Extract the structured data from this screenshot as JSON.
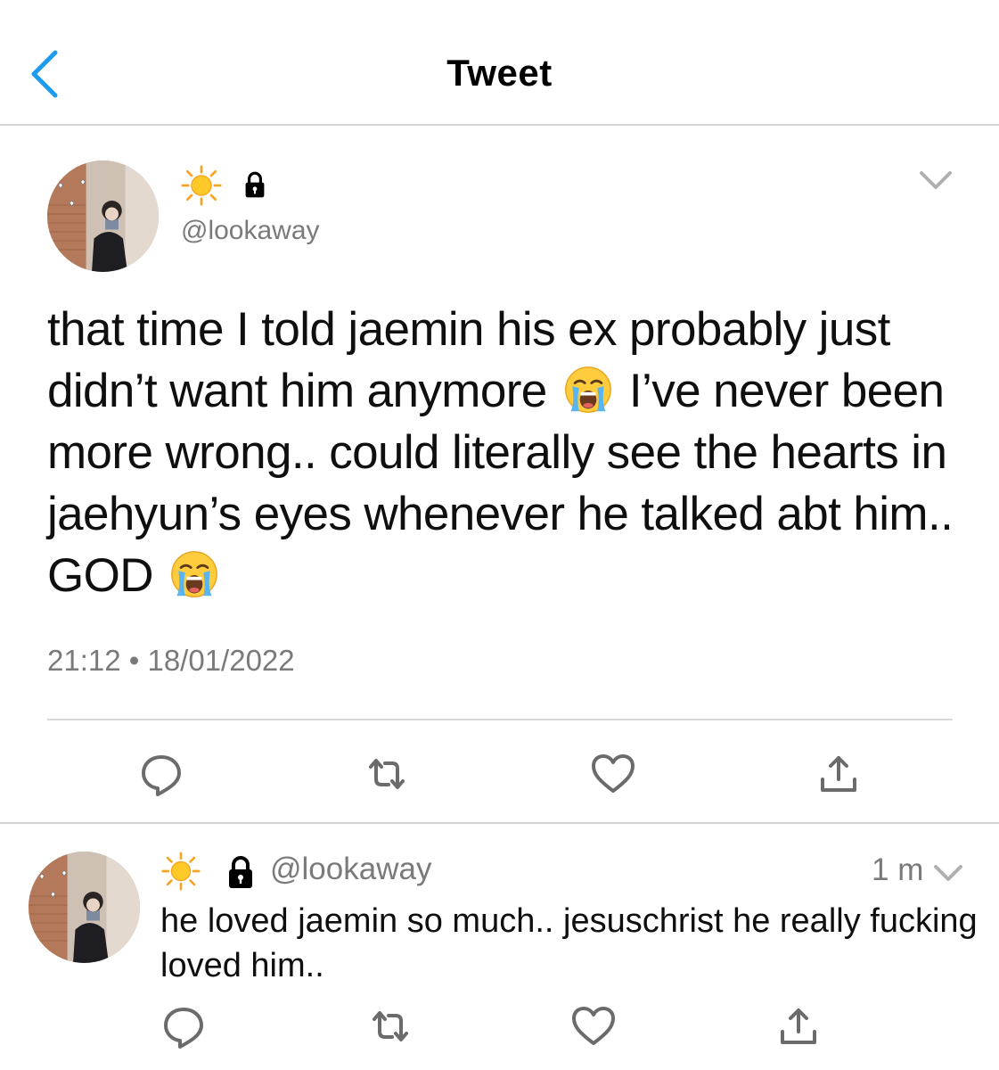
{
  "header": {
    "title": "Tweet",
    "back_icon": "chevron-left-icon"
  },
  "colors": {
    "accent": "#1d9bf0",
    "secondary_text": "#7a7a7a",
    "divider": "#d4d4d4"
  },
  "tweet": {
    "display_name_icons": [
      "sun-emoji",
      "lock-icon"
    ],
    "handle": "@lookaway",
    "text_parts": [
      "that time I told jaemin his ex probably just didn’t want him anymore",
      "I’ve never been more wrong.. could literally see the hearts in jaehyun’s eyes whenever he talked abt him.. GOD"
    ],
    "text_emojis": [
      "loudly-crying-face",
      "loudly-crying-face"
    ],
    "timestamp": "21:12 • 18/01/2022",
    "actions": [
      "reply-icon",
      "retweet-icon",
      "like-icon",
      "share-icon"
    ]
  },
  "reply": {
    "display_name_icons": [
      "sun-emoji",
      "lock-icon"
    ],
    "handle": "@lookaway",
    "time": "1 m",
    "text": "he loved jaemin so much.. jesuschrist he really fucking loved him..",
    "actions": [
      "reply-icon",
      "retweet-icon",
      "like-icon",
      "share-icon"
    ]
  }
}
